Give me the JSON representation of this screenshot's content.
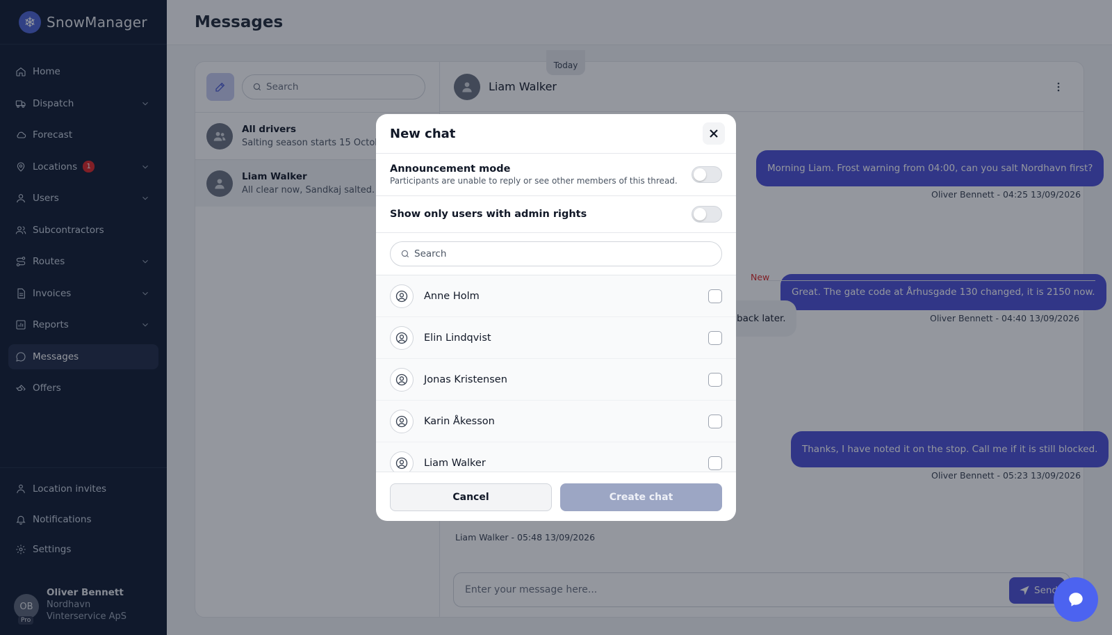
{
  "app": {
    "name": "SnowManager"
  },
  "sidebar": {
    "items": [
      {
        "label": "Home",
        "icon": "home-icon"
      },
      {
        "label": "Dispatch",
        "icon": "truck-icon"
      },
      {
        "label": "Forecast",
        "icon": "cloud-icon"
      },
      {
        "label": "Locations",
        "icon": "map-pin-icon",
        "badge": "1"
      },
      {
        "label": "Users",
        "icon": "user-icon"
      },
      {
        "label": "Subcontractors",
        "icon": "users-icon"
      },
      {
        "label": "Routes",
        "icon": "route-icon"
      },
      {
        "label": "Invoices",
        "icon": "invoice-icon"
      },
      {
        "label": "Reports",
        "icon": "chart-icon"
      },
      {
        "label": "Messages",
        "icon": "message-icon"
      },
      {
        "label": "Offers",
        "icon": "offer-icon"
      }
    ],
    "bottom": [
      {
        "label": "Location invites",
        "icon": "location-invite-icon"
      },
      {
        "label": "Notifications",
        "icon": "bell-icon"
      },
      {
        "label": "Settings",
        "icon": "gear-icon"
      }
    ],
    "user": {
      "initials": "OB",
      "plan": "Pro",
      "name": "Oliver Bennett",
      "company": "Nordhavn Vinterservice ApS"
    }
  },
  "header": {
    "title": "Messages"
  },
  "conversations": {
    "search_placeholder": "Search",
    "items": [
      {
        "name": "All drivers",
        "preview": "Salting season starts 15 October. Please check your routes"
      },
      {
        "name": "Liam Walker",
        "preview": "All clear now, Sandkaj salted. Heading to the next stop"
      }
    ]
  },
  "chat": {
    "name": "Liam Walker",
    "day_label": "Today",
    "new_label": "New",
    "messages": [
      {
        "text": "Morning Liam. Frost warning from 04:00, can you salt Nordhavn first?",
        "meta": "Oliver Bennett - 04:25 13/09/2026"
      },
      {
        "text": "Great. The gate code at Århusgade 130 changed, it is 2150 now.",
        "meta": "Oliver Bennett - 04:40 13/09/2026"
      },
      {
        "text": "back later."
      },
      {
        "text": "Thanks, I have noted it on the stop. Call me if it is still blocked.",
        "meta": "Oliver Bennett - 05:23 13/09/2026"
      },
      {
        "meta": "Liam Walker - 05:48 13/09/2026"
      }
    ],
    "composer_placeholder": "Enter your message here...",
    "send_label": "Send"
  },
  "modal": {
    "title": "New chat",
    "announcement": {
      "title": "Announcement mode",
      "subtitle": "Participants are unable to reply or see other members of this thread.",
      "enabled": false
    },
    "admin_only": {
      "title": "Show only users with admin rights",
      "enabled": false
    },
    "search_placeholder": "Search",
    "users": [
      {
        "name": "Anne Holm",
        "checked": false
      },
      {
        "name": "Elin Lindqvist",
        "checked": false
      },
      {
        "name": "Jonas Kristensen",
        "checked": false
      },
      {
        "name": "Karin Åkesson",
        "checked": false
      },
      {
        "name": "Liam Walker",
        "checked": false
      }
    ],
    "cancel_label": "Cancel",
    "create_label": "Create chat"
  },
  "colors": {
    "sidebar_bg": "#0f1b31",
    "accent": "#4c4fd6",
    "badge": "#dc2626",
    "new_marker": "#dc2626"
  }
}
